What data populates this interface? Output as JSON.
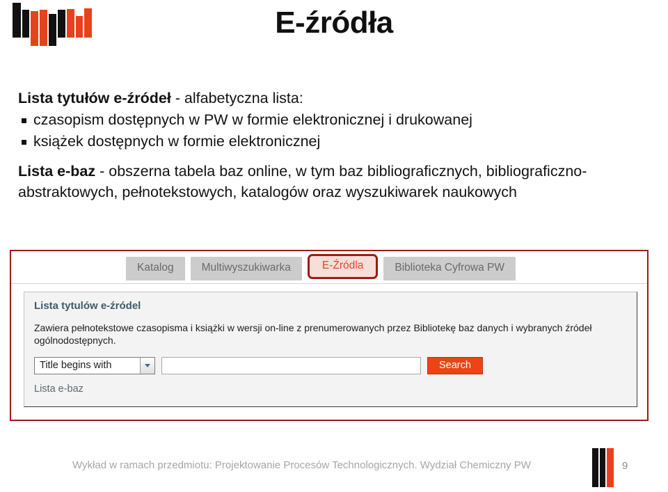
{
  "slide": {
    "title": "E-źródła",
    "logo_name": "politechnika-warszawska-logo",
    "colors": {
      "accent_red": "#e8411d",
      "logo_black": "#111111",
      "frame_red": "#9d1b16",
      "panel_heading": "#3f5a6b",
      "footer_gray": "#a6a6a6"
    }
  },
  "content": {
    "lead_bold": "Lista tytułów e-źródeł",
    "lead_rest": " - alfabetyczna lista:",
    "bullets": [
      "czasopism dostępnych w PW w formie elektronicznej i drukowanej",
      "książek dostępnych w formie elektronicznej"
    ],
    "second_bold": "Lista e-baz",
    "second_rest": " - obszerna tabela baz online, w tym baz bibliograficznych, bibliograficzno-abstraktowych, pełnotekstowych, katalogów oraz wyszukiwarek naukowych"
  },
  "screenshot": {
    "tabs": [
      {
        "label": "Katalog",
        "active": false
      },
      {
        "label": "Multiwyszukiwarka",
        "active": false
      },
      {
        "label": "E-Źródla",
        "active": true
      },
      {
        "label": "Biblioteka Cyfrowa PW",
        "active": false
      }
    ],
    "panel": {
      "title": "Lista tytulów e-źródel",
      "description": "Zawiera pełnotekstowe czasopisma i książki w wersji on-line z prenumerowanych przez Bibliotekę baz danych i wybranych źródeł ogólnodostępnych.",
      "select_value": "Title begins with",
      "select_options": [
        "Title begins with"
      ],
      "query_value": "",
      "query_placeholder": "",
      "search_button": "Search",
      "link": "Lista e-baz"
    }
  },
  "footer": {
    "text": "Wykład w ramach przedmiotu: Projektowanie Procesów Technologicznych. Wydział Chemiczny PW",
    "page_number": "9"
  }
}
